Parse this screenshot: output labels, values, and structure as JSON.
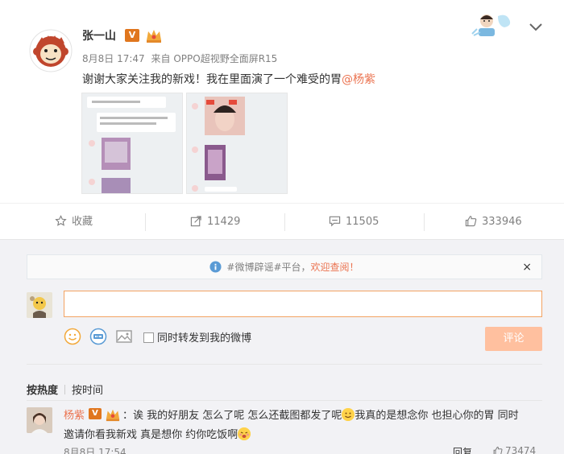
{
  "post": {
    "author": "张一山",
    "verified_badge": "V",
    "time": "8月8日 17:47",
    "source_prefix": "来自",
    "source": "OPPO超视野全面屏R15",
    "text": "谢谢大家关注我的新戏！我在里面演了一个难受的胃",
    "mention": "@杨紫"
  },
  "actions": {
    "favorite_label": "收藏",
    "repost_count": "11429",
    "comment_count": "11505",
    "like_count": "333946"
  },
  "comment_box": {
    "notice_text": "#微博辟谣#平台，",
    "notice_link": "欢迎查阅！",
    "close_label": "×",
    "input_value": "",
    "repost_option_label": "同时转发到我的微博",
    "submit_label": "评论"
  },
  "sort": {
    "hot": "按热度",
    "time": "按时间"
  },
  "comment": {
    "name": "杨紫",
    "verified_badge": "V",
    "line1_a": "：诶 我的好朋友 怎么了呢 怎么还截图都发了呢",
    "line1_b": "我真的是想念你 也担心你的胃 同时",
    "line2": "邀请你看我新戏 真是想你 约你吃饭啊",
    "time": "8月8日 17:54",
    "reply_label": "回复",
    "like_count": "73474"
  },
  "colors": {
    "accent": "#eb7350",
    "badge": "#e0761e",
    "input_border": "#f3a362",
    "submit_bg": "#ffc09f"
  }
}
